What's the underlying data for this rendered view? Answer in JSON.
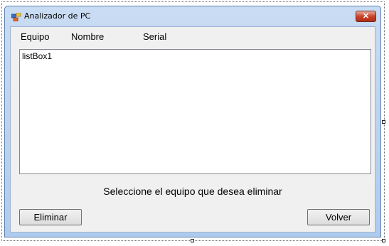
{
  "window": {
    "title": "Analizador de PC",
    "close_label": "✕"
  },
  "headers": {
    "equipo": "Equipo",
    "nombre": "Nombre",
    "serial": "Serial"
  },
  "listbox": {
    "items": [
      "listBox1"
    ]
  },
  "message": "Seleccione el equipo que desea eliminar",
  "buttons": {
    "eliminar": "Eliminar",
    "volver": "Volver"
  },
  "colors": {
    "close_button": "#c7452c",
    "client_background": "#f0f0f0",
    "titlebar": "#c9dcf3"
  },
  "icons": {
    "window_icon": "app-window-icon",
    "close": "close-icon"
  }
}
